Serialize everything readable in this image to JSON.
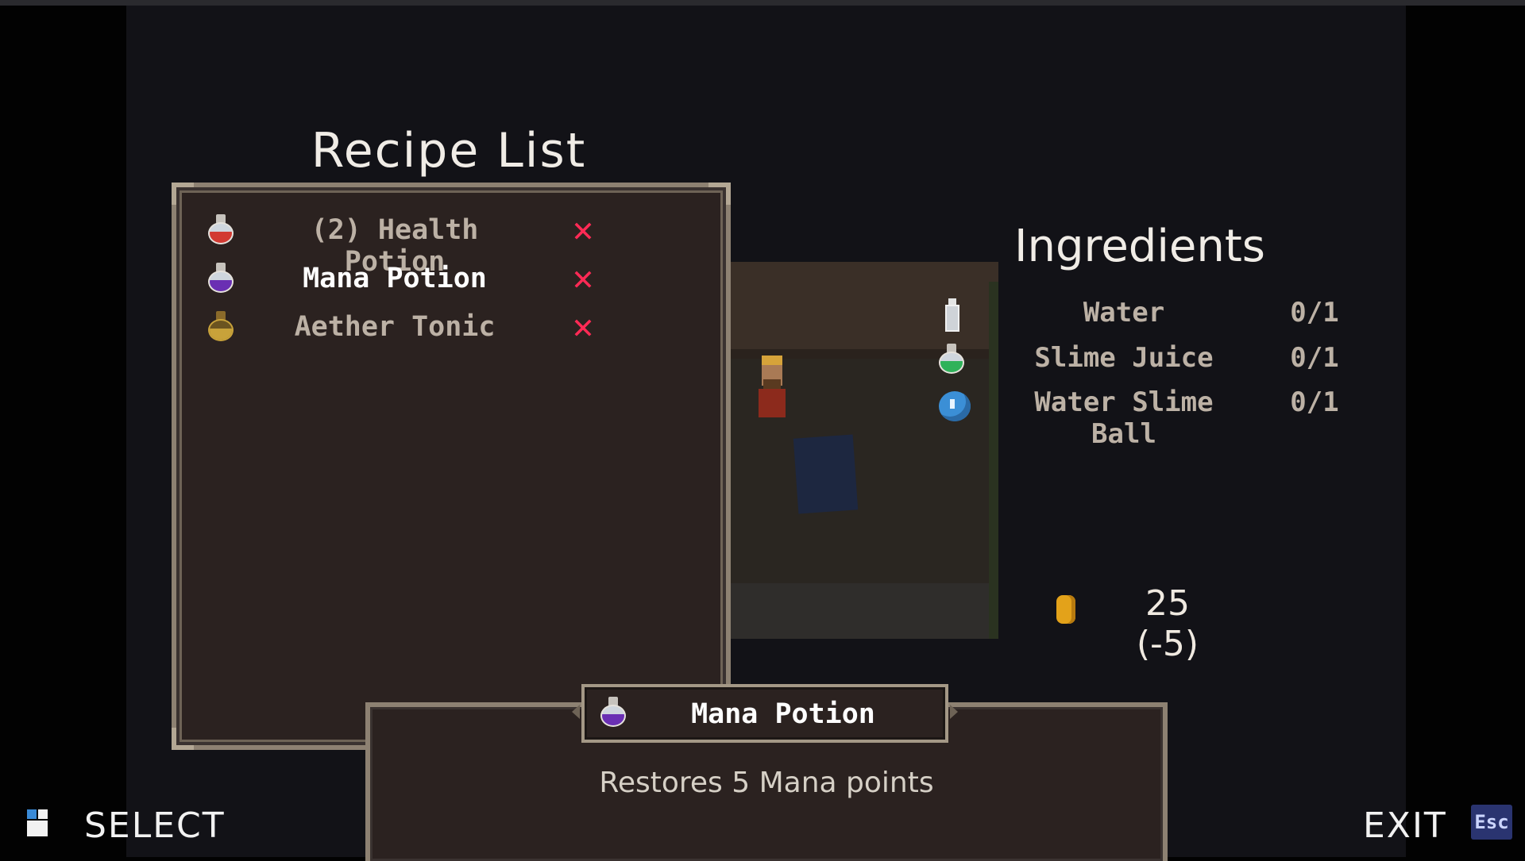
{
  "recipe_list": {
    "title": "Recipe List",
    "items": [
      {
        "name": "(2) Health Potion",
        "icon": "health-potion-icon",
        "liquid_color": "#d23a32",
        "status": "✕",
        "selected": false
      },
      {
        "name": "Mana Potion",
        "icon": "mana-potion-icon",
        "liquid_color": "#6a2fb3",
        "status": "✕",
        "selected": true
      },
      {
        "name": "Aether Tonic",
        "icon": "aether-tonic-icon",
        "liquid_color": "#c8a23a",
        "status": "✕",
        "selected": false
      }
    ]
  },
  "ingredients": {
    "title": "Ingredients",
    "items": [
      {
        "name": "Water",
        "count": "0/1",
        "icon": "water-bottle-icon"
      },
      {
        "name": "Slime Juice",
        "count": "0/1",
        "icon": "slime-juice-icon"
      },
      {
        "name": "Water Slime Ball",
        "count": "0/1",
        "icon": "water-slime-ball-icon"
      }
    ]
  },
  "cost": {
    "amount": "25",
    "delta": "(-5)",
    "icon": "coin-icon"
  },
  "selected_item": {
    "name": "Mana Potion",
    "description": "Restores 5 Mana points",
    "icon": "mana-potion-icon"
  },
  "footer": {
    "select_label": "SELECT",
    "exit_label": "EXIT",
    "esc_key": "Esc"
  },
  "colors": {
    "status_red": "#ff2a55",
    "panel_bg": "#2b2220",
    "border": "#8d8172"
  }
}
